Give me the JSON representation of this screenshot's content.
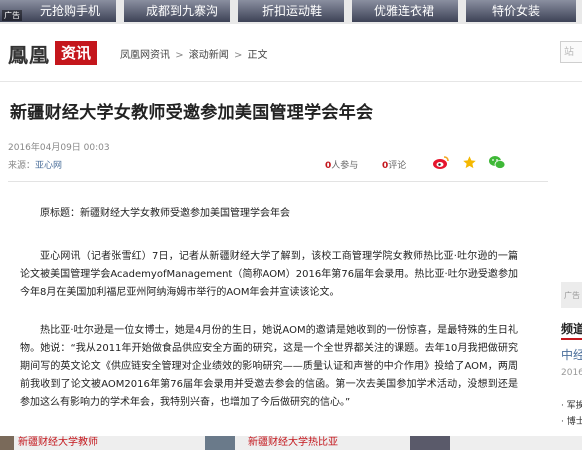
{
  "ads": {
    "badge": "广告",
    "items": [
      {
        "label": "元抢购手机",
        "color": "#2f3550"
      },
      {
        "label": "成都到九寨沟",
        "color": "#3a4a6a"
      },
      {
        "label": "折扣运动鞋",
        "color": "#3b3f52"
      },
      {
        "label": "优雅连衣裙",
        "color": "#4a4f63"
      },
      {
        "label": "特价女装",
        "color": "#2f3247"
      }
    ]
  },
  "header": {
    "logo_main": "鳳凰",
    "logo_sub": "资讯",
    "breadcrumb": [
      "凤凰网资讯",
      "滚动新闻",
      "正文"
    ],
    "breadcrumb_sep": ">",
    "search_placeholder": "站"
  },
  "article": {
    "title": "新疆财经大学女教师受邀参加美国管理学会年会",
    "date": "2016年04月09日 00:03",
    "source_label": "来源：",
    "source_name": "亚心网",
    "participants": {
      "count": "0",
      "label": "人参与"
    },
    "comments": {
      "count": "0",
      "label": "评论"
    },
    "paragraphs": [
      "原标题：新疆财经大学女教师受邀参加美国管理学会年会",
      "亚心网讯（记者张雪红）7日，记者从新疆财经大学了解到，该校工商管理学院女教师热比亚·吐尔逊的一篇论文被美国管理学会AcademyofManagement（简称AOM）2016年第76届年会录用。热比亚·吐尔逊受邀参加今年8月在美国加利福尼亚州阿纳海姆市举行的AOM年会并宣读该论文。",
      "热比亚·吐尔逊是一位女博士，她是4月份的生日，她说AOM的邀请是她收到的一份惊喜，是最特殊的生日礼物。她说：“我从2011年开始做食品供应安全方面的研究，这是一个全世界都关注的课题。去年10月我把做研究期间写的英文论文《供应链安全管理对企业绩效的影响研究——质量认证和声誉的中介作用》投给了AOM，两周前我收到了论文被AOM2016年第76届年会录用并受邀去参会的信函。第一次去美国参加学术活动，没想到还是参加这么有影响力的学术年会，我特别兴奋，也增加了今后做研究的信心。”"
    ]
  },
  "sidebar": {
    "ad_badge": "广告",
    "title": "频道",
    "news": "中经",
    "date": "2016-",
    "items": [
      "· 军挨",
      "· 博士"
    ]
  },
  "bottom": {
    "items": [
      "新疆财经大学教师",
      "新疆财经大学热比亚"
    ]
  },
  "colors": {
    "brand": "#c4161c",
    "link": "#4a6e9a"
  },
  "icons": [
    "weibo-icon",
    "star-icon",
    "wechat-icon"
  ]
}
